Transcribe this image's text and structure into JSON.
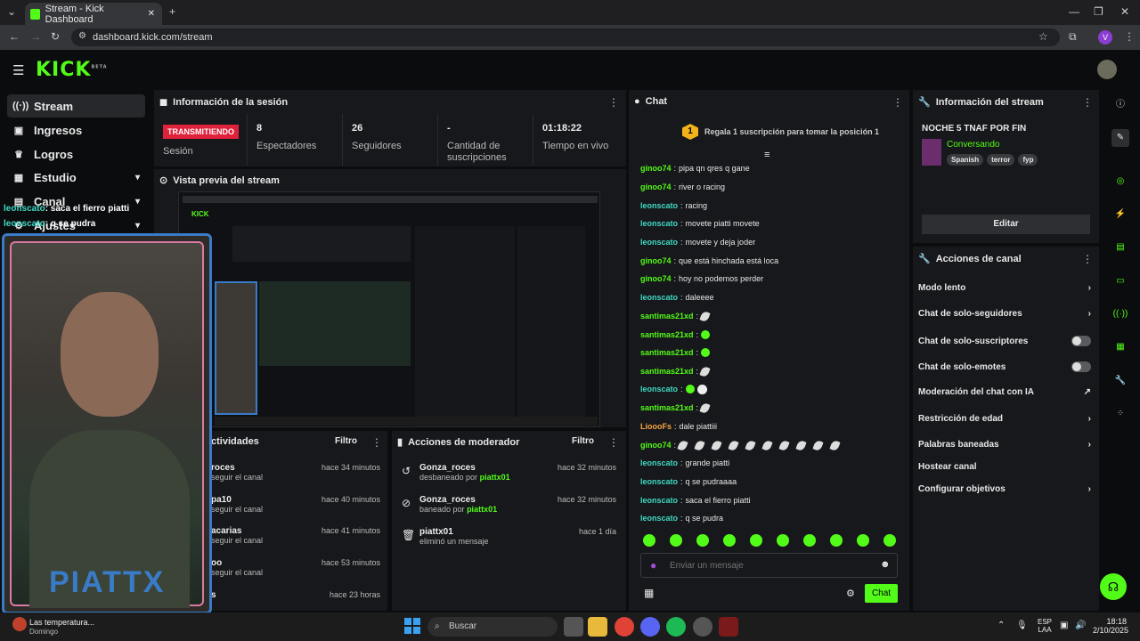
{
  "browser": {
    "tab_title": "Stream - Kick Dashboard",
    "url": "dashboard.kick.com/stream",
    "profile_initial": "V"
  },
  "header": {
    "logo": "KICK",
    "logo_sup": "BETA"
  },
  "sidebar": {
    "items": [
      {
        "label": "Stream",
        "icon": "broadcast-icon"
      },
      {
        "label": "Ingresos",
        "icon": "wallet-icon"
      },
      {
        "label": "Logros",
        "icon": "trophy-icon"
      },
      {
        "label": "Estudio",
        "icon": "studio-icon"
      },
      {
        "label": "Canal",
        "icon": "channel-icon"
      },
      {
        "label": "Ajustes",
        "icon": "settings-icon"
      }
    ]
  },
  "overlay": {
    "chat_lines": [
      {
        "user": "leonscato",
        "text": ": saca el fierro piatti"
      },
      {
        "user": "leonscato",
        "text": ": q se pudra"
      }
    ],
    "cam_name": "PIATTX"
  },
  "session": {
    "title": "Información de la sesión",
    "live_badge": "TRANSMITIENDO",
    "live_label": "Sesión",
    "stats": [
      {
        "value": "8",
        "label": "Espectadores"
      },
      {
        "value": "26",
        "label": "Seguidores"
      },
      {
        "value": "-",
        "label": "Cantidad de suscripciones"
      },
      {
        "value": "01:18:22",
        "label": "Tiempo en vivo"
      }
    ]
  },
  "preview": {
    "title": "Vista previa del stream"
  },
  "activities": {
    "title": "ctividades",
    "filter": "Filtro",
    "items": [
      {
        "name": "roces",
        "sub": "seguir el canal",
        "time": "hace 34 minutos"
      },
      {
        "name": "pa10",
        "sub": "seguir el canal",
        "time": "hace 40 minutos"
      },
      {
        "name": "acarias",
        "sub": "seguir el canal",
        "time": "hace 41 minutos"
      },
      {
        "name": "oo",
        "sub": "seguir el canal",
        "time": "hace 53 minutos"
      },
      {
        "name": "s",
        "sub": "",
        "time": "hace 23 horas"
      }
    ]
  },
  "mod_actions": {
    "title": "Acciones de moderador",
    "filter": "Filtro",
    "items": [
      {
        "name": "Gonza_roces",
        "sub": "desbaneado por",
        "by": "piattx01",
        "time": "hace 32 minutos",
        "icon": "undo-icon"
      },
      {
        "name": "Gonza_roces",
        "sub": "baneado por",
        "by": "piattx01",
        "time": "hace 32 minutos",
        "icon": "ban-icon"
      },
      {
        "name": "piattx01",
        "sub": "eliminó un mensaje",
        "by": "",
        "time": "hace 1 día",
        "icon": "trash-icon"
      }
    ]
  },
  "chat": {
    "title": "Chat",
    "gift_rank": "1",
    "gift_text": "Regala 1 suscripción para tomar la posición 1",
    "messages": [
      {
        "user": "ginoo74",
        "text": "pipa qn qres q gane",
        "color": "green"
      },
      {
        "user": "ginoo74",
        "text": "river o racing",
        "color": "green"
      },
      {
        "user": "leonscato",
        "text": "racing",
        "color": "teal"
      },
      {
        "user": "leonscato",
        "text": "movete piatti movete",
        "color": "teal"
      },
      {
        "user": "leonscato",
        "text": "movete y deja joder",
        "color": "teal"
      },
      {
        "user": "ginoo74",
        "text": "que está hinchada está loca",
        "color": "green"
      },
      {
        "user": "ginoo74",
        "text": "hoy no podemos perder",
        "color": "green"
      },
      {
        "user": "leonscato",
        "text": "daleeee",
        "color": "teal"
      },
      {
        "user": "santimas21xd",
        "text": "",
        "color": "green"
      },
      {
        "user": "santimas21xd",
        "text": "",
        "color": "green"
      },
      {
        "user": "santimas21xd",
        "text": "",
        "color": "green"
      },
      {
        "user": "santimas21xd",
        "text": "",
        "color": "green"
      },
      {
        "user": "leonscato",
        "text": "",
        "color": "teal"
      },
      {
        "user": "santimas21xd",
        "text": "",
        "color": "green"
      },
      {
        "user": "LioooFs",
        "text": "dale piattiii",
        "color": "orange"
      },
      {
        "user": "ginoo74",
        "text": "",
        "color": "green"
      },
      {
        "user": "leonscato",
        "text": "grande piatti",
        "color": "teal"
      },
      {
        "user": "leonscato",
        "text": "q se pudraaaa",
        "color": "teal"
      },
      {
        "user": "leonscato",
        "text": "saca el fierro piatti",
        "color": "teal"
      },
      {
        "user": "leonscato",
        "text": "q se pudra",
        "color": "teal"
      }
    ],
    "input_placeholder": "Enviar un mensaje",
    "send_label": "Chat"
  },
  "stream_info": {
    "title": "Información del stream",
    "stream_title": "NOCHE 5 TNAF POR FIN",
    "category": "Conversando",
    "tags": [
      "Spanish",
      "terror",
      "fyp"
    ],
    "edit_label": "Editar"
  },
  "channel_actions": {
    "title": "Acciones de canal",
    "items": [
      {
        "label": "Modo lento",
        "control": "chevron"
      },
      {
        "label": "Chat de solo-seguidores",
        "control": "chevron"
      },
      {
        "label": "Chat de solo-suscriptores",
        "control": "toggle"
      },
      {
        "label": "Chat de solo-emotes",
        "control": "toggle"
      },
      {
        "label": "Moderación del chat con IA",
        "control": "external"
      },
      {
        "label": "Restricción de edad",
        "control": "chevron"
      },
      {
        "label": "Palabras baneadas",
        "control": "chevron"
      },
      {
        "label": "Hostear canal",
        "control": "none"
      },
      {
        "label": "Configurar objetivos",
        "control": "chevron"
      }
    ]
  },
  "taskbar": {
    "weather": "Las temperatura...",
    "weather_sub": "Domingo",
    "search": "Buscar",
    "lang": "ESP",
    "lang_sub": "LAA",
    "time": "18:18",
    "date": "2/10/2025"
  },
  "colors": {
    "brand": "#53fc18",
    "live": "#e0213b",
    "panel": "#17181b",
    "bg": "#0b0c0e"
  }
}
